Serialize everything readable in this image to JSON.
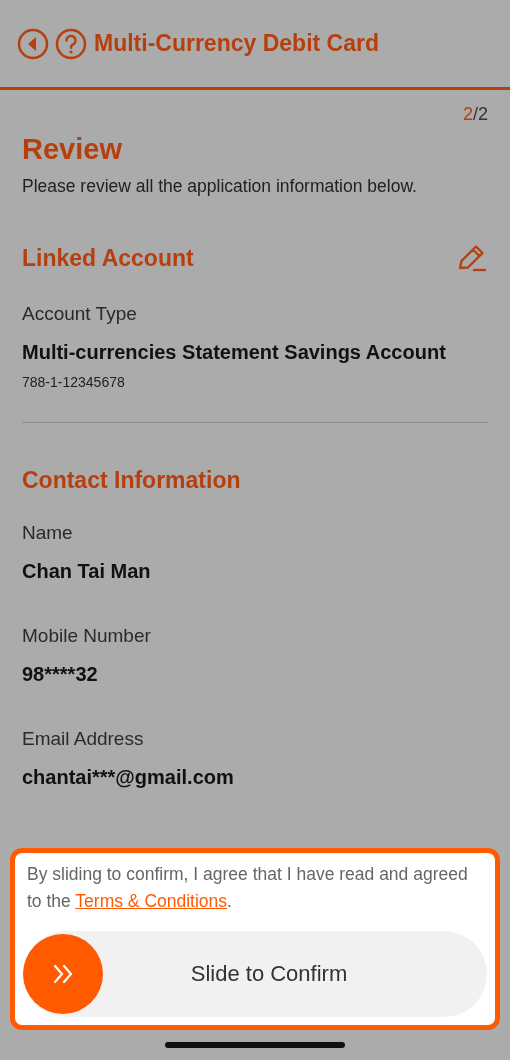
{
  "header": {
    "title": "Multi-Currency Debit Card"
  },
  "step": {
    "current": "2",
    "total": "/2"
  },
  "review": {
    "title": "Review",
    "subtitle": "Please review all the application information below."
  },
  "sections": [
    {
      "title": "Linked Account",
      "editable": true,
      "fields": [
        {
          "label": "Account Type",
          "value": "Multi-currencies Statement Savings Account",
          "detail": "788-1-12345678"
        }
      ]
    },
    {
      "title": "Contact Information",
      "editable": false,
      "fields": [
        {
          "label": "Name",
          "value": "Chan Tai Man"
        },
        {
          "label": "Mobile Number",
          "value": "98****32"
        },
        {
          "label": "Email Address",
          "value": "chantai***@gmail.com"
        }
      ]
    }
  ],
  "confirm": {
    "agreement_prefix": "By sliding to confirm, I agree that I have read and agreed to the ",
    "link": "Terms & Conditions",
    "agreement_suffix": ".",
    "slider_label": "Slide to Confirm"
  }
}
